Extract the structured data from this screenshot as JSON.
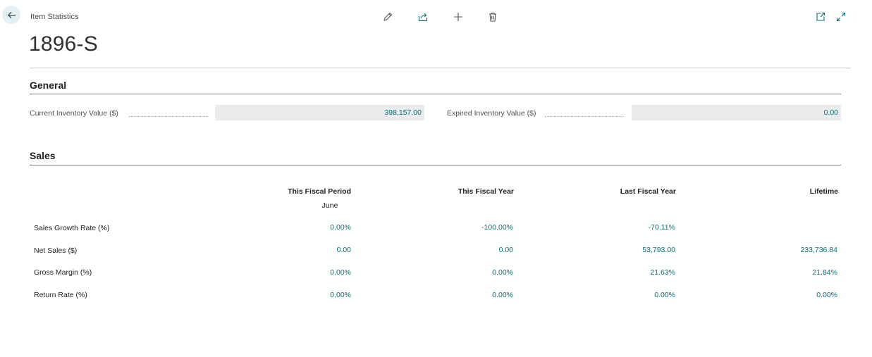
{
  "header": {
    "caption": "Item Statistics",
    "title": "1896-S"
  },
  "icons": {
    "back": "arrow-left-icon",
    "edit": "pencil-icon",
    "share": "share-icon",
    "add": "plus-icon",
    "delete": "trash-icon",
    "open_new": "open-new-window-icon",
    "expand": "expand-icon"
  },
  "colors": {
    "accent": "#00717a",
    "back_button_bg": "#e3f0f3",
    "field_bg": "#eaebec"
  },
  "general": {
    "title": "General",
    "current_inventory_label": "Current Inventory Value ($)",
    "current_inventory_value": "398,157.00",
    "expired_inventory_label": "Expired Inventory Value ($)",
    "expired_inventory_value": "0.00"
  },
  "sales": {
    "title": "Sales",
    "columns": [
      {
        "label": "This Fiscal Period",
        "sub": "June"
      },
      {
        "label": "This Fiscal Year",
        "sub": ""
      },
      {
        "label": "Last Fiscal Year",
        "sub": ""
      },
      {
        "label": "Lifetime",
        "sub": ""
      }
    ],
    "rows": [
      {
        "label": "Sales Growth Rate (%)",
        "values": [
          "0.00%",
          "-100.00%",
          "-70.11%",
          ""
        ]
      },
      {
        "label": "Net Sales ($)",
        "values": [
          "0.00",
          "0.00",
          "53,793.00",
          "233,736.84"
        ]
      },
      {
        "label": "Gross Margin (%)",
        "values": [
          "0.00%",
          "0.00%",
          "21.63%",
          "21.84%"
        ]
      },
      {
        "label": "Return Rate (%)",
        "values": [
          "0.00%",
          "0.00%",
          "0.00%",
          "0.00%"
        ]
      }
    ]
  }
}
